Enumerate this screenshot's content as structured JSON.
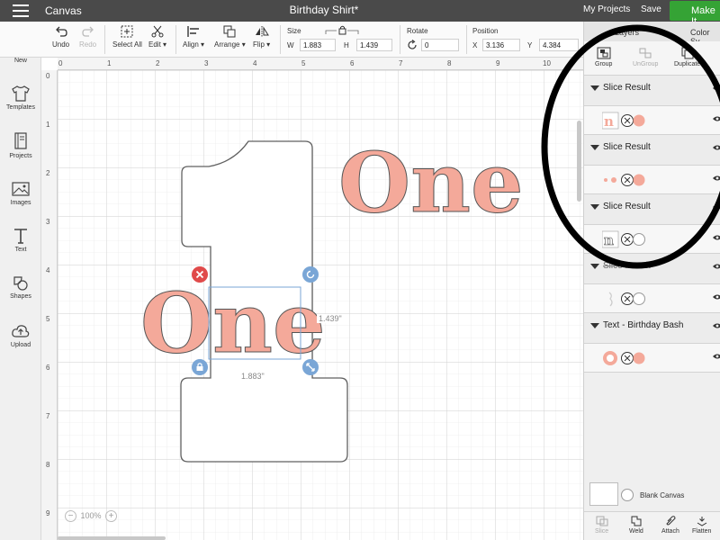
{
  "topbar": {
    "app_name": "Canvas",
    "doc_title": "Birthday Shirt*",
    "my_projects": "My Projects",
    "save": "Save",
    "make_it": "Make It"
  },
  "toolbar": {
    "undo": "Undo",
    "redo": "Redo",
    "select_all": "Select All",
    "edit": "Edit",
    "align": "Align",
    "arrange": "Arrange",
    "flip": "Flip",
    "size_label": "Size",
    "w_prefix": "W",
    "w_value": "1.883",
    "h_prefix": "H",
    "h_value": "1.439",
    "rotate_label": "Rotate",
    "rotate_value": "0",
    "position_label": "Position",
    "x_prefix": "X",
    "x_value": "3.136",
    "y_prefix": "Y",
    "y_value": "4.384"
  },
  "leftbar": {
    "items": [
      {
        "label": "New",
        "icon": "plus-circle-icon"
      },
      {
        "label": "Templates",
        "icon": "shirt-icon"
      },
      {
        "label": "Projects",
        "icon": "book-icon"
      },
      {
        "label": "Images",
        "icon": "image-icon"
      },
      {
        "label": "Text",
        "icon": "text-icon"
      },
      {
        "label": "Shapes",
        "icon": "shapes-icon"
      },
      {
        "label": "Upload",
        "icon": "cloud-upload-icon"
      }
    ]
  },
  "canvas": {
    "ruler_top": [
      "0",
      "1",
      "2",
      "3",
      "4",
      "5",
      "6",
      "7",
      "8",
      "9",
      "10"
    ],
    "ruler_left": [
      "0",
      "1",
      "2",
      "3",
      "4",
      "5",
      "6",
      "7",
      "8",
      "9"
    ],
    "big_number": "1",
    "word_one_left": "One",
    "word_one_right": "One",
    "dim_width": "1.883\"",
    "dim_height": "1.439\"",
    "zoom_level": "100%",
    "colors": {
      "salmon": "#f4a99a",
      "outline": "#555555",
      "selection": "#7aa6d6",
      "delete": "#e04a4a"
    }
  },
  "panel": {
    "tab_layers": "Layers",
    "tab_color": "Color Sy",
    "actions": [
      {
        "label": "Group",
        "enabled": true
      },
      {
        "label": "UnGroup",
        "enabled": false
      },
      {
        "label": "Duplicate",
        "enabled": true
      }
    ],
    "groups": [
      {
        "title": "Slice Result"
      },
      {
        "title": "Slice Result"
      },
      {
        "title": "Slice Result"
      },
      {
        "title": "Slice Result"
      },
      {
        "title": "Text - Birthday Bash"
      }
    ],
    "blank_canvas": "Blank Canvas",
    "bottom_tools": [
      {
        "label": "Slice",
        "enabled": false
      },
      {
        "label": "Weld",
        "enabled": true
      },
      {
        "label": "Attach",
        "enabled": true
      },
      {
        "label": "Flatten",
        "enabled": true
      }
    ]
  }
}
